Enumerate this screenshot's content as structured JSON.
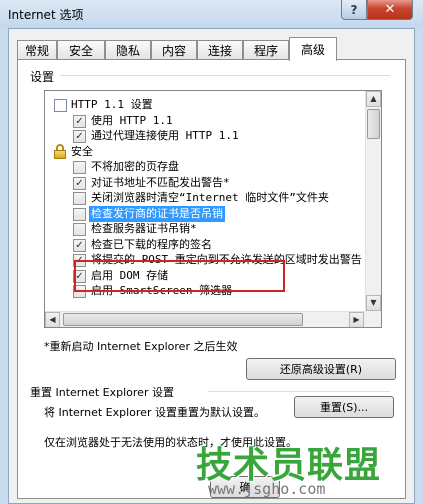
{
  "window": {
    "title": "Internet 选项",
    "help_glyph": "?",
    "close_glyph": "✕"
  },
  "tabs": [
    "常规",
    "安全",
    "隐私",
    "内容",
    "连接",
    "程序",
    "高级"
  ],
  "active_tab": "高级",
  "settings": {
    "group_label": "设置",
    "items": [
      {
        "kind": "header",
        "text": "HTTP 1.1 设置",
        "icon": "page-icon"
      },
      {
        "kind": "check",
        "text": "使用 HTTP 1.1",
        "checked": true
      },
      {
        "kind": "check",
        "text": "通过代理连接使用 HTTP 1.1",
        "checked": true
      },
      {
        "kind": "header",
        "text": "安全",
        "icon": "lock-icon"
      },
      {
        "kind": "check",
        "text": "不将加密的页存盘",
        "checked": false
      },
      {
        "kind": "check",
        "text": "对证书地址不匹配发出警告*",
        "checked": true
      },
      {
        "kind": "check",
        "text": "关闭浏览器时清空“Internet 临时文件”文件夹",
        "checked": false
      },
      {
        "kind": "check",
        "text": "检查发行商的证书是否吊销",
        "checked": false,
        "selected": true
      },
      {
        "kind": "check",
        "text": "检查服务器证书吊销*",
        "checked": false
      },
      {
        "kind": "check",
        "text": "检查已下载的程序的签名",
        "checked": true
      },
      {
        "kind": "check",
        "text": "将提交的 POST 重定向到不允许发送的区域时发出警告",
        "checked": true
      },
      {
        "kind": "check",
        "text": "启用 DOM 存储",
        "checked": true
      },
      {
        "kind": "check",
        "text": "启用 SmartScreen 筛选器",
        "checked": false
      }
    ],
    "restart_note": "*重新启动 Internet Explorer 之后生效",
    "restore_button": "还原高级设置(R)"
  },
  "reset": {
    "group_label": "重置 Internet Explorer 设置",
    "desc": "将 Internet Explorer 设置重置为默认设置。",
    "button": "重置(S)...",
    "note": "仅在浏览器处于无法使用的状态时，才使用此设置。"
  },
  "footer": {
    "ok_fragment": "确"
  },
  "watermark": {
    "text": "技术员联盟",
    "url": "www.jsgho.com"
  }
}
